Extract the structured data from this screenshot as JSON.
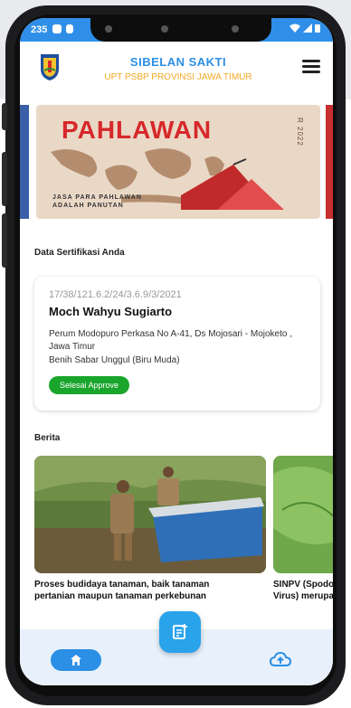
{
  "status_bar": {
    "time": "235"
  },
  "header": {
    "title": "SIBELAN SAKTI",
    "subtitle": "UPT PSBP PROVINSI JAWA TIMUR"
  },
  "banner": {
    "title": "PAHLAWAN",
    "side_text": "R 2022",
    "caption_line1": "JASA PARA PAHLAWAN",
    "caption_line2": "ADALAH PANUTAN"
  },
  "certificate_section": {
    "label": "Data Sertifikasi Anda",
    "number": "17/38/121.6.2/24/3.6.9/3/2021",
    "name": "Moch Wahyu Sugiarto",
    "address": "Perum Modopuro Perkasa No A-41, Ds Mojosari - Mojoketo , Jawa Timur",
    "seed_type": "Benih Sabar Unggul (Biru Muda)",
    "status": "Selesai Approve",
    "status_color": "#1aa52c"
  },
  "news_section": {
    "label": "Berita",
    "items": [
      {
        "title": "Proses budidaya tanaman, baik tanaman pertanian maupun tanaman perkebunan"
      },
      {
        "title": "SINPV (Spodo Virus) merupa"
      }
    ]
  },
  "bottom_nav": {
    "items": [
      {
        "icon": "home-icon"
      },
      {
        "icon": "note-add-icon"
      },
      {
        "icon": "cloud-upload-icon"
      }
    ]
  },
  "colors": {
    "primary": "#2b8fe6",
    "accent": "#f3a825",
    "success": "#1aa52c"
  }
}
